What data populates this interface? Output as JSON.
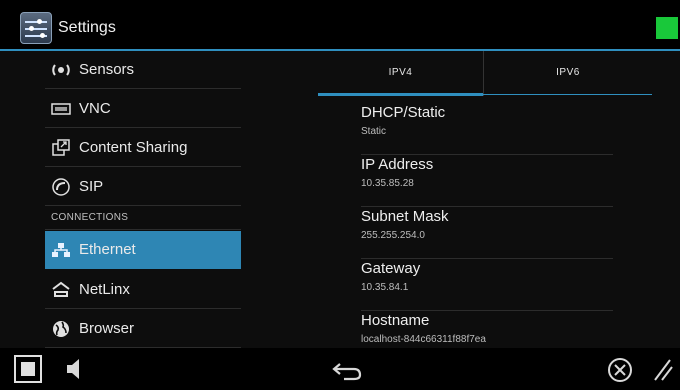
{
  "header": {
    "title": "Settings",
    "status_color": "#19c83a",
    "icon": "settings-sliders-icon"
  },
  "sidebar": {
    "items": [
      {
        "label": "Sensors",
        "icon": "sensors-icon"
      },
      {
        "label": "VNC",
        "icon": "vnc-icon"
      },
      {
        "label": "Content Sharing",
        "icon": "content-sharing-icon"
      },
      {
        "label": "SIP",
        "icon": "sip-icon"
      },
      {
        "label": "Ethernet",
        "icon": "ethernet-icon",
        "active": true
      },
      {
        "label": "NetLinx",
        "icon": "netlinx-icon"
      },
      {
        "label": "Browser",
        "icon": "browser-globe-icon"
      }
    ],
    "section_header": "CONNECTIONS",
    "active_color": "#2e86b4"
  },
  "tabs": {
    "items": [
      {
        "label": "IPV4",
        "selected": true
      },
      {
        "label": "IPV6",
        "selected": false
      }
    ],
    "accent_color": "#2f8fbf"
  },
  "fields": [
    {
      "name": "DHCP/Static",
      "value": "Static"
    },
    {
      "name": "IP Address",
      "value": "10.35.85.28"
    },
    {
      "name": "Subnet Mask",
      "value": "255.255.254.0"
    },
    {
      "name": "Gateway",
      "value": "10.35.84.1"
    },
    {
      "name": "Hostname",
      "value": "localhost-844c66311f88f7ea"
    }
  ],
  "navbar": {
    "icons": [
      "recent-apps-square-icon",
      "volume-speaker-icon",
      "back-arrow-icon",
      "close-circle-icon",
      "resize-handle-icon"
    ]
  }
}
